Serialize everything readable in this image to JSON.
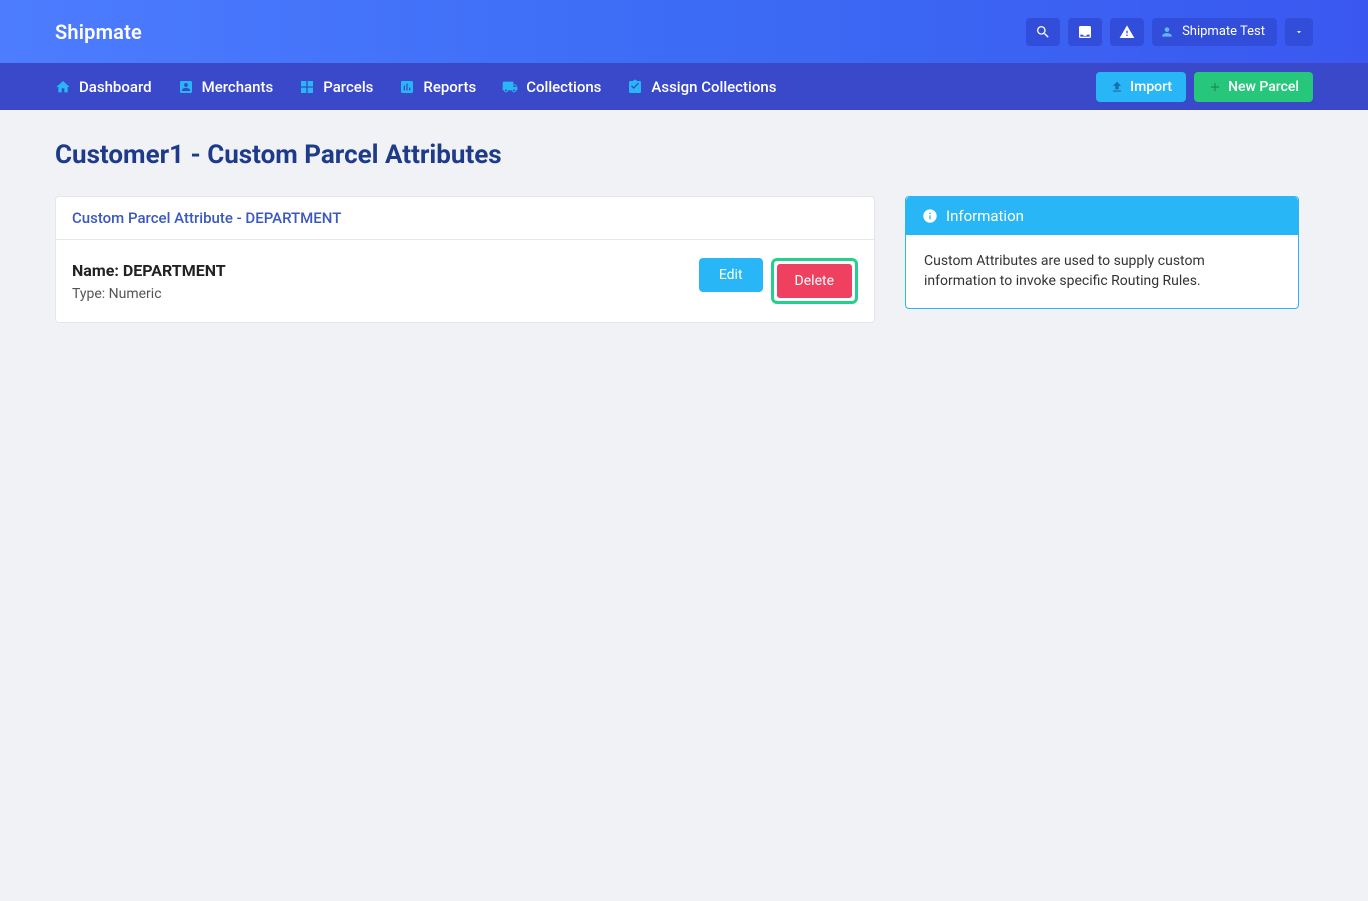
{
  "brand": "Shipmate",
  "header": {
    "user_label": "Shipmate Test"
  },
  "nav": {
    "items": [
      {
        "label": "Dashboard"
      },
      {
        "label": "Merchants"
      },
      {
        "label": "Parcels"
      },
      {
        "label": "Reports"
      },
      {
        "label": "Collections"
      },
      {
        "label": "Assign Collections"
      }
    ],
    "import_label": "Import",
    "new_parcel_label": "New Parcel"
  },
  "page": {
    "title": "Customer1 - Custom Parcel Attributes",
    "card_header": "Custom Parcel Attribute - DEPARTMENT",
    "attribute": {
      "name_label": "Name: DEPARTMENT",
      "type_label": "Type: Numeric"
    },
    "edit_label": "Edit",
    "delete_label": "Delete"
  },
  "info": {
    "header": "Information",
    "body": "Custom Attributes are used to supply custom information to invoke specific Routing Rules."
  }
}
